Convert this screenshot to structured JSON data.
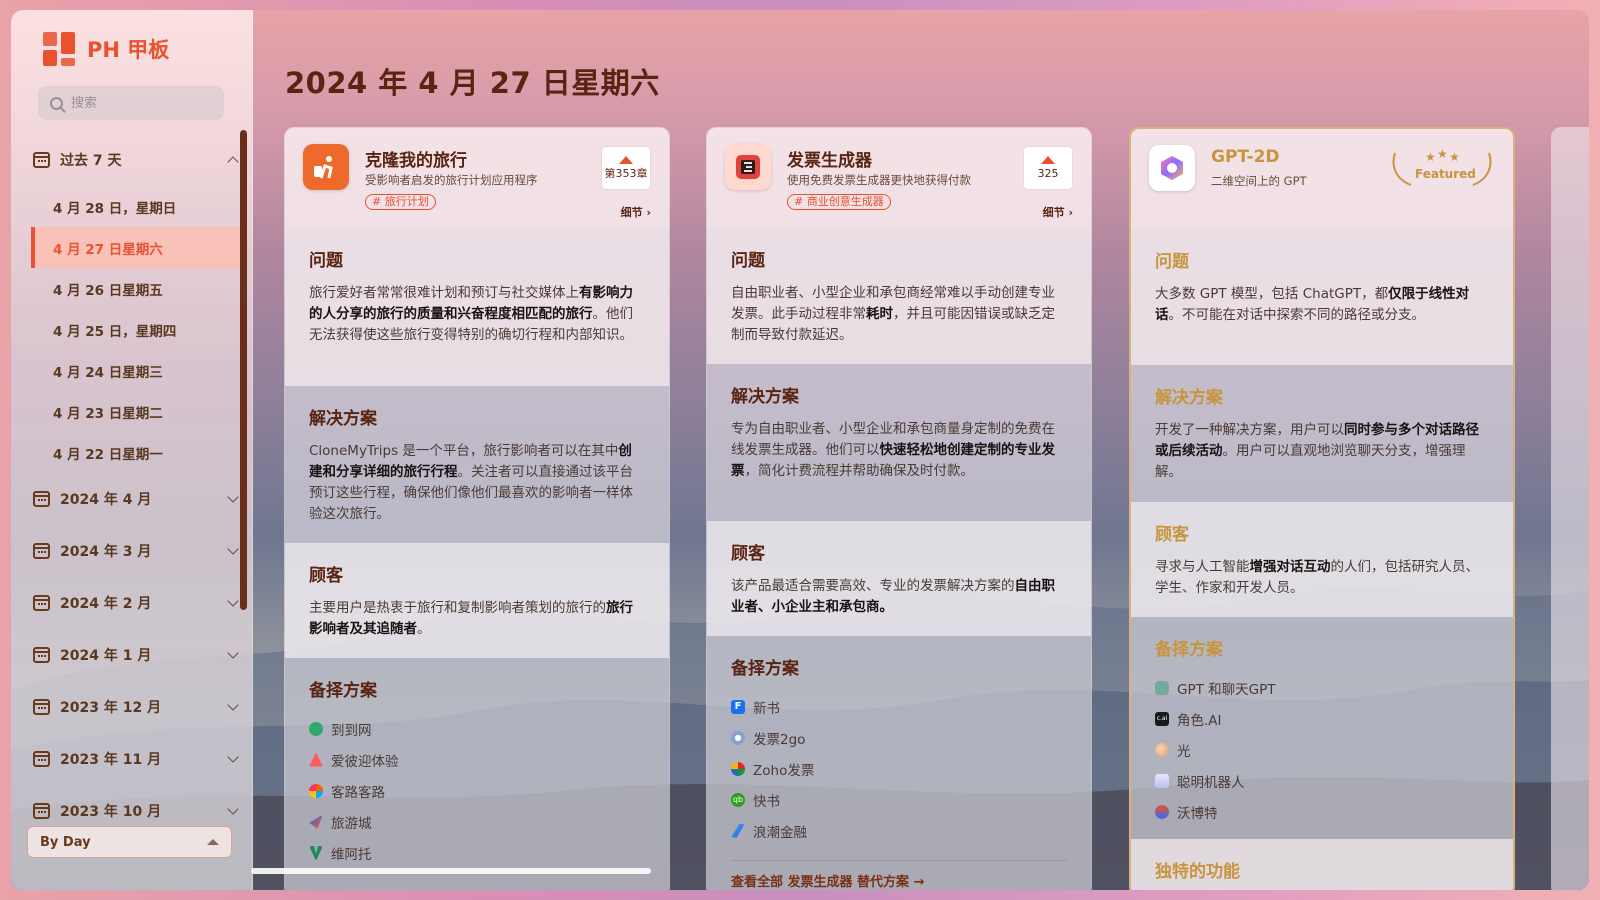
{
  "app": {
    "name": "PH 甲板"
  },
  "search": {
    "placeholder": "搜索"
  },
  "nav": {
    "past7": "过去 7 天",
    "days": [
      "4 月 28 日，星期日",
      "4 月 27 日星期六",
      "4 月 26 日星期五",
      "4 月 25 日，星期四",
      "4 月 24 日星期三",
      "4 月 23 日星期二",
      "4 月 22 日星期一"
    ],
    "months": [
      "2024 年 4 月",
      "2024 年 3 月",
      "2024 年 2 月",
      "2024 年 1 月",
      "2023 年 12 月",
      "2023 年 11 月",
      "2023 年 10 月"
    ]
  },
  "view_select": {
    "value": "By Day"
  },
  "page_title": "2024 年 4 月 27 日星期六",
  "cards": [
    {
      "title": "克隆我的旅行",
      "subtitle": "受影响者启发的旅行计划应用程序",
      "tag": "# 旅行计划",
      "votes": "第353章",
      "details": "细节 ›",
      "problem_h": "问题",
      "problem_pre": "旅行爱好者常常很难计划和预订与社交媒体上",
      "problem_bold": "有影响力的人分享的旅行的质量和兴奋程度相匹配的旅行",
      "problem_post": "。他们无法获得使这些旅行变得特别的确切行程和内部知识。",
      "solution_h": "解决方案",
      "solution_pre": "CloneMyTrips 是一个平台，旅行影响者可以在其中",
      "solution_bold": "创建和分享详细的旅行行程",
      "solution_post": "。关注者可以直接通过该平台预订这些行程，确保他们像他们最喜欢的影响者一样体验这次旅行。",
      "customer_h": "顾客",
      "customer_pre": "主要用户是热衷于旅行和复制影响者策划的旅行的",
      "customer_bold": "旅行影响者及其追随者",
      "customer_post": "。",
      "alt_h": "备择方案",
      "alternatives": [
        "到到网",
        "爱彼迎体验",
        "客路客路",
        "旅游城",
        "维阿托"
      ]
    },
    {
      "title": "发票生成器",
      "subtitle": "使用免费发票生成器更快地获得付款",
      "tag": "# 商业创意生成器",
      "votes": "325",
      "details": "细节 ›",
      "problem_h": "问题",
      "problem_pre": "自由职业者、小型企业和承包商经常难以手动创建专业发票。此手动过程非常",
      "problem_bold": "耗时",
      "problem_post": "，并且可能因错误或缺乏定制而导致付款延迟。",
      "solution_h": "解决方案",
      "solution_pre": "专为自由职业者、小型企业和承包商量身定制的免费在线发票生成器。他们可以",
      "solution_bold": "快速轻松地创建定制的专业发票",
      "solution_post": "，简化计费流程并帮助确保及时付款。",
      "customer_h": "顾客",
      "customer_pre": "该产品最适合需要高效、专业的发票解决方案的",
      "customer_bold": "自由职业者、小企业主和承包商。",
      "customer_post": "",
      "alt_h": "备择方案",
      "alternatives": [
        "新书",
        "发票2go",
        "Zoho发票",
        "快书",
        "浪潮金融"
      ],
      "view_all": "查看全部 发票生成器 替代方案 →"
    },
    {
      "title": "GPT-2D",
      "subtitle": "二维空间上的 GPT",
      "featured": "Featured",
      "problem_h": "问题",
      "problem_pre": "大多数 GPT 模型，包括 ChatGPT，都",
      "problem_bold": "仅限于线性对话",
      "problem_post": "。不可能在对话中探索不同的路径或分支。",
      "solution_h": "解决方案",
      "solution_pre": "开发了一种解决方案，用户可以",
      "solution_bold": "同时参与多个对话路径或后续活动",
      "solution_post": "。用户可以直观地浏览聊天分支，增强理解。",
      "customer_h": "顾客",
      "customer_pre": "寻求与人工智能",
      "customer_bold": "增强对话互动",
      "customer_post": "的人们，包括研究人员、学生、作家和开发人员。",
      "alt_h": "备择方案",
      "alternatives": [
        "GPT 和聊天GPT",
        "角色.AI",
        "光",
        "聪明机器人",
        "沃博特"
      ],
      "unique_h": "独特的功能"
    }
  ]
}
